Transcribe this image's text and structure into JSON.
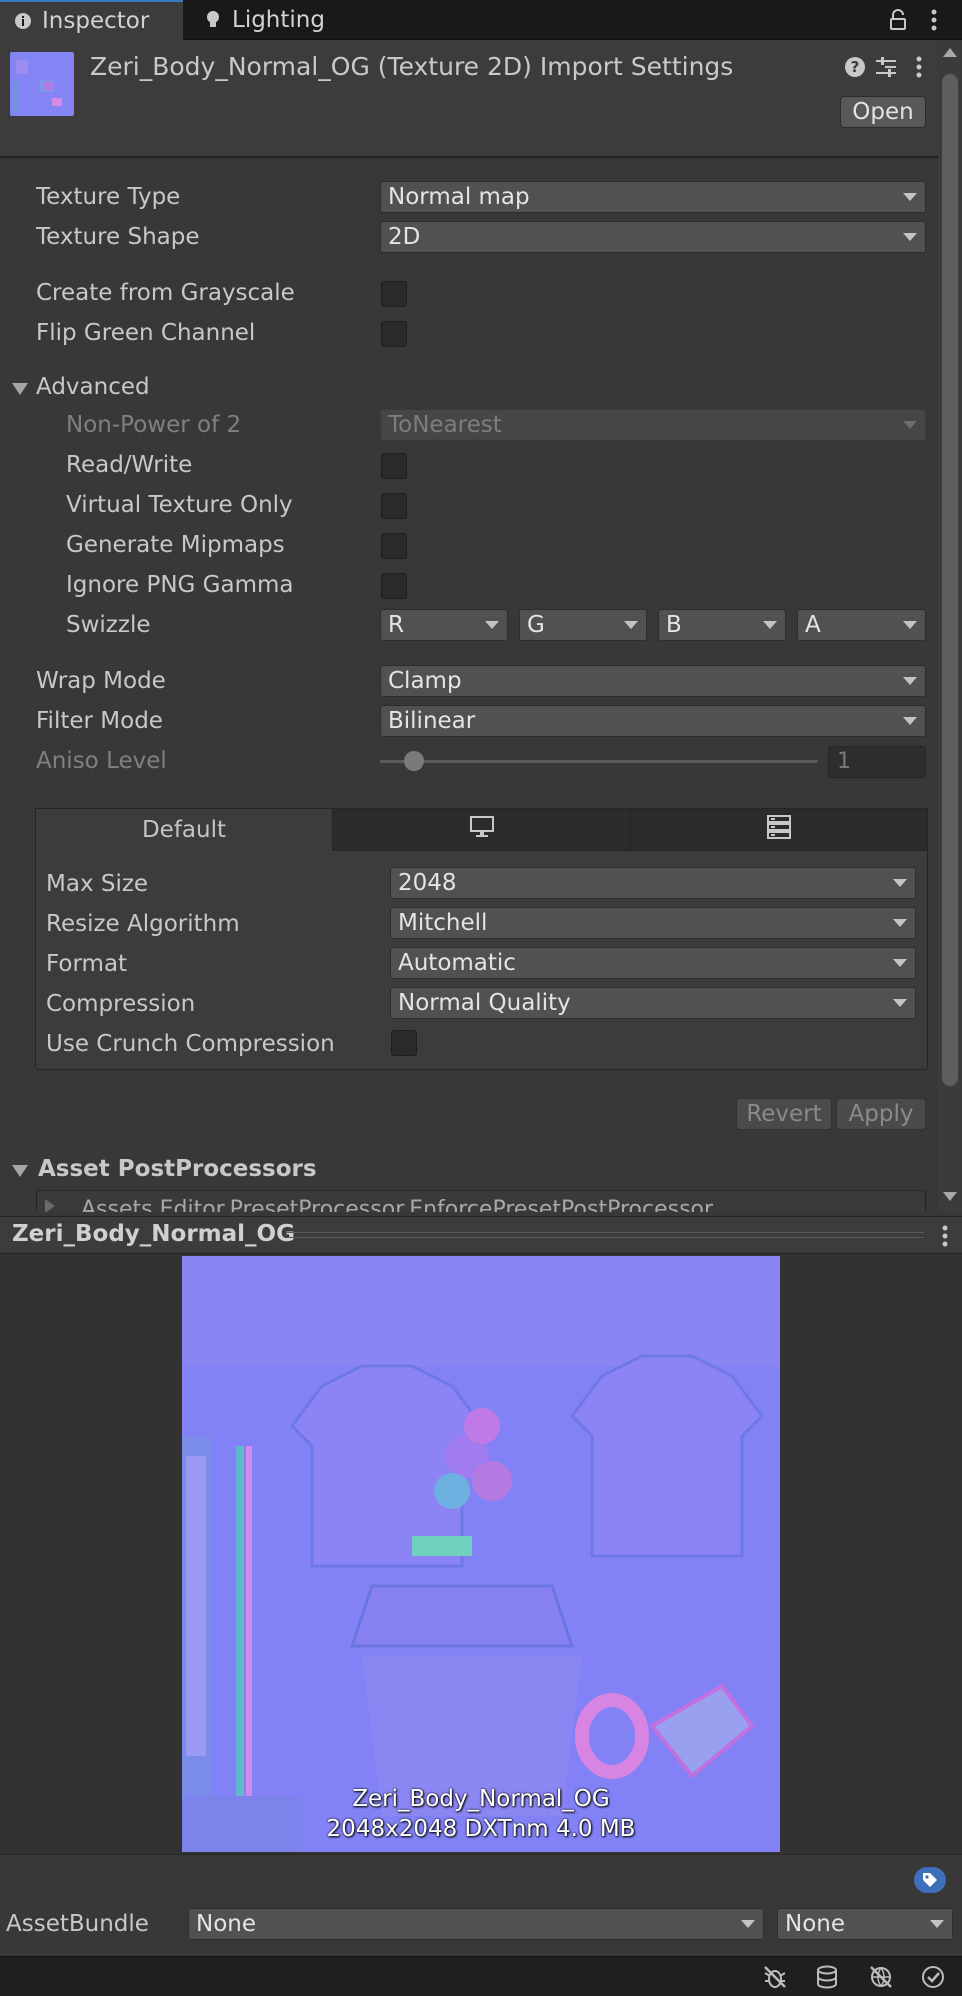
{
  "tabs": [
    {
      "label": "Inspector",
      "icon": "info-icon",
      "active": true
    },
    {
      "label": "Lighting",
      "icon": "lightbulb-icon",
      "active": false
    }
  ],
  "header": {
    "title": "Zeri_Body_Normal_OG (Texture 2D) Import Settings",
    "open_label": "Open"
  },
  "props": {
    "texture_type": {
      "label": "Texture Type",
      "value": "Normal map"
    },
    "texture_shape": {
      "label": "Texture Shape",
      "value": "2D"
    },
    "create_from_grayscale": {
      "label": "Create from Grayscale",
      "checked": false
    },
    "flip_green": {
      "label": "Flip Green Channel",
      "checked": false
    }
  },
  "advanced": {
    "label": "Advanced",
    "non_power_of_2": {
      "label": "Non-Power of 2",
      "value": "ToNearest"
    },
    "read_write": {
      "label": "Read/Write",
      "checked": false
    },
    "virtual_texture_only": {
      "label": "Virtual Texture Only",
      "checked": false
    },
    "generate_mipmaps": {
      "label": "Generate Mipmaps",
      "checked": false
    },
    "ignore_png_gamma": {
      "label": "Ignore PNG Gamma",
      "checked": false
    },
    "swizzle": {
      "label": "Swizzle",
      "r": "R",
      "g": "G",
      "b": "B",
      "a": "A"
    }
  },
  "wrap_mode": {
    "label": "Wrap Mode",
    "value": "Clamp"
  },
  "filter_mode": {
    "label": "Filter Mode",
    "value": "Bilinear"
  },
  "aniso_level": {
    "label": "Aniso Level",
    "value": "1",
    "fraction": 0.0
  },
  "platform": {
    "tabs": [
      {
        "label": "Default",
        "icon": null
      },
      {
        "label": "",
        "icon": "monitor-icon"
      },
      {
        "label": "",
        "icon": "server-icon"
      }
    ],
    "max_size": {
      "label": "Max Size",
      "value": "2048"
    },
    "resize_algorithm": {
      "label": "Resize Algorithm",
      "value": "Mitchell"
    },
    "format": {
      "label": "Format",
      "value": "Automatic"
    },
    "compression": {
      "label": "Compression",
      "value": "Normal Quality"
    },
    "use_crunch": {
      "label": "Use Crunch Compression",
      "checked": false
    }
  },
  "actions": {
    "revert": "Revert",
    "apply": "Apply"
  },
  "post_processors": {
    "label": "Asset PostProcessors",
    "item": "Assets.Editor.PresetProcessor.EnforcePresetPostProcessor"
  },
  "preview": {
    "title": "Zeri_Body_Normal_OG",
    "caption_name": "Zeri_Body_Normal_OG",
    "caption_info": "2048x2048  DXTnm   4.0 MB"
  },
  "assetbundle": {
    "label": "AssetBundle",
    "name": "None",
    "variant": "None"
  },
  "status_icons": [
    "bug-off-icon",
    "database-icon",
    "network-off-icon",
    "check-circle-icon"
  ],
  "colors": {
    "accent": "#3a79bb",
    "panel": "#383838",
    "normal_map": "#8282f6"
  }
}
